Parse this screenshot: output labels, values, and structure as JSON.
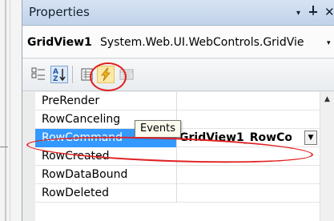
{
  "window": {
    "title": "Properties",
    "pin_arrow": "▾",
    "pin_glyph": "⊥",
    "close_glyph": "✕"
  },
  "object_selector": {
    "name": "GridView1",
    "type": "System.Web.UI.WebControls.GridVie",
    "dropdown_glyph": "▾"
  },
  "toolbar": {
    "buttons": [
      {
        "name": "categorized",
        "icon": "categorized-icon",
        "active": false
      },
      {
        "name": "alphabetical",
        "icon": "sort-az-icon",
        "active": true
      },
      {
        "name": "properties",
        "icon": "properties-icon",
        "active": false
      },
      {
        "name": "events",
        "icon": "lightning-icon",
        "active": true
      },
      {
        "name": "property-pages",
        "icon": "property-pages-icon",
        "active": false
      }
    ],
    "alpha_label": "A",
    "alpha_sub": "Z",
    "alpha_arrow": "↓"
  },
  "tooltip": {
    "text": "Events"
  },
  "grid": {
    "rows": [
      {
        "name": "PreRender",
        "value": ""
      },
      {
        "name": "RowCanceling",
        "value": ""
      },
      {
        "name": "RowCommand",
        "value": "GridView1_RowCor",
        "selected": true
      },
      {
        "name": "RowCreated",
        "value": ""
      },
      {
        "name": "RowDataBound",
        "value": ""
      },
      {
        "name": "RowDeleted",
        "value": ""
      }
    ],
    "scroll_up_glyph": "▲",
    "value_dropdown_glyph": "▼"
  },
  "annotations": {
    "highlight_color": "#e02020"
  },
  "colors": {
    "selection": "#3399ff",
    "title_bar": "#c8d8ee"
  }
}
